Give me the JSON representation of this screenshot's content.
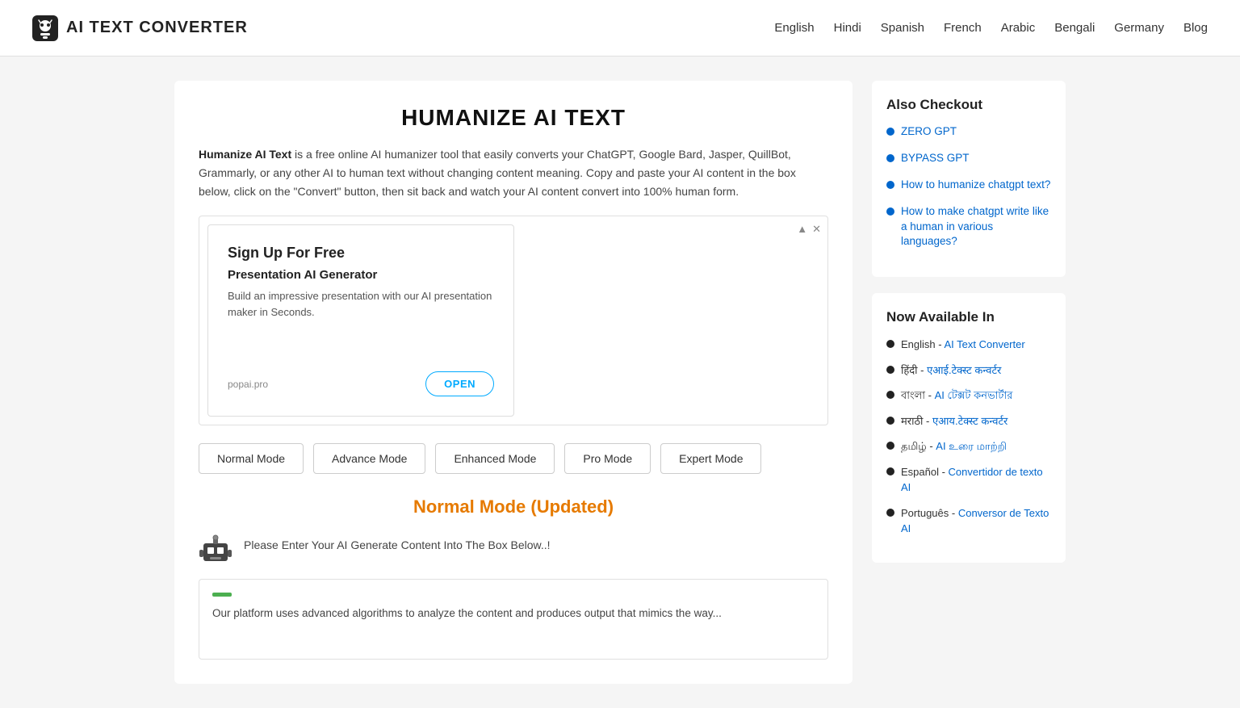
{
  "header": {
    "logo_text": "AI TEXT CONVERTER",
    "nav_links": [
      {
        "label": "English",
        "href": "#"
      },
      {
        "label": "Hindi",
        "href": "#"
      },
      {
        "label": "Spanish",
        "href": "#"
      },
      {
        "label": "French",
        "href": "#"
      },
      {
        "label": "Arabic",
        "href": "#"
      },
      {
        "label": "Bengali",
        "href": "#"
      },
      {
        "label": "Germany",
        "href": "#"
      },
      {
        "label": "Blog",
        "href": "#"
      }
    ]
  },
  "main": {
    "page_title": "HUMANIZE AI TEXT",
    "intro_bold": "Humanize AI Text",
    "intro_text": " is a free online AI humanizer tool that easily converts your ChatGPT, Google Bard, Jasper, QuillBot, Grammarly, or any other AI to human text without changing content meaning. Copy and paste your AI content in the box below, click on the \"Convert\" button, then sit back and watch your AI content convert into 100% human form.",
    "ad": {
      "signup_label": "Sign Up For Free",
      "product_label": "Presentation AI Generator",
      "desc": "Build an impressive presentation with our AI presentation maker in Seconds.",
      "domain": "popai.pro",
      "open_btn": "OPEN"
    },
    "mode_buttons": [
      "Normal Mode",
      "Advance Mode",
      "Enhanced Mode",
      "Pro Mode",
      "Expert Mode"
    ],
    "section_heading": "Normal Mode (Updated)",
    "instruction_text": "Please Enter Your AI Generate Content Into The Box Below..!",
    "textarea_content": "Our platform uses advanced algorithms to analyze the content and produces output that mimics the way..."
  },
  "sidebar": {
    "also_checkout_title": "Also Checkout",
    "also_checkout_links": [
      {
        "label": "ZERO GPT",
        "href": "#"
      },
      {
        "label": "BYPASS GPT",
        "href": "#"
      },
      {
        "label": "How to humanize chatgpt text?",
        "href": "#"
      },
      {
        "label": "How to make chatgpt write like a human in various languages?",
        "href": "#"
      }
    ],
    "available_title": "Now Available In",
    "available_items": [
      {
        "prefix": "English - ",
        "link_label": "AI Text Converter",
        "href": "#"
      },
      {
        "prefix": "हिंदी - ",
        "link_label": "एआई.टेक्स्ट कन्वर्टर",
        "href": "#"
      },
      {
        "prefix": "বাংলা - ",
        "link_label": "AI টেক্সট কনভার্টার",
        "href": "#"
      },
      {
        "prefix": "मराठी - ",
        "link_label": "एआय.टेक्स्ट कन्वर्टर",
        "href": "#"
      },
      {
        "prefix": "தமிழ் - ",
        "link_label": "AI உரை மாற்றி",
        "href": "#"
      },
      {
        "prefix": "Español - ",
        "link_label": "Convertidor de texto AI",
        "href": "#"
      },
      {
        "prefix": "Português - ",
        "link_label": "Conversor de Texto AI",
        "href": "#"
      }
    ]
  }
}
